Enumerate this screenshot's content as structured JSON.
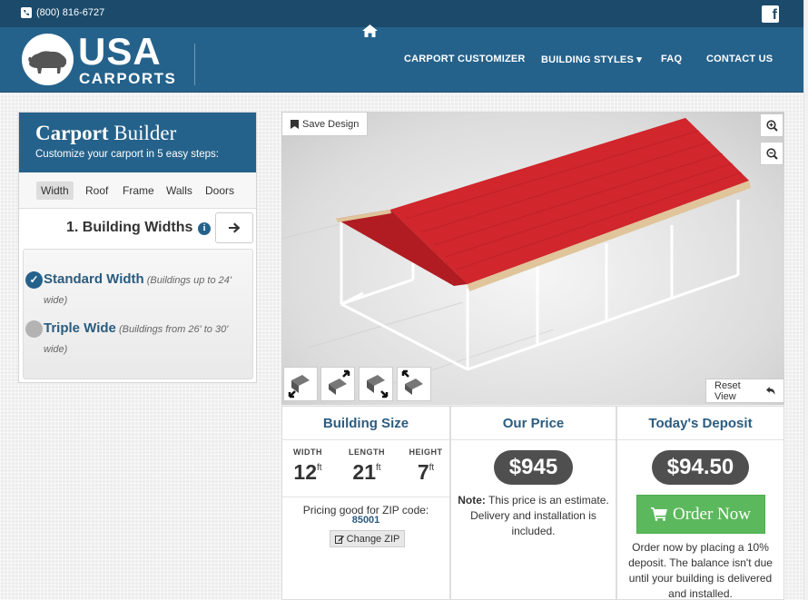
{
  "topbar": {
    "phone": "(800) 816-6727"
  },
  "logo": {
    "usa": "USA",
    "carports": "CARPORTS"
  },
  "nav": {
    "customizer": "CARPORT CUSTOMIZER",
    "styles": "BUILDING STYLES ▾",
    "faq": "FAQ",
    "contact": "CONTACT US"
  },
  "builder": {
    "title_bold": "Carport",
    "title_rest": " Builder",
    "subtitle": "Customize your carport in 5 easy steps:",
    "tabs": [
      "Width",
      "Roof",
      "Frame",
      "Walls",
      "Doors"
    ],
    "step_title": "1. Building Widths",
    "options": [
      {
        "label": "Standard Width",
        "desc": " (Buildings up to 24' wide)",
        "selected": true
      },
      {
        "label": "Triple Wide",
        "desc": " (Buildings from 26' to 30' wide)",
        "selected": false
      }
    ]
  },
  "viewer": {
    "save_label": "Save Design",
    "reset_label": "Reset View",
    "roof_color": "#c62026",
    "trim_color": "#e0c49a"
  },
  "size": {
    "heading": "Building Size",
    "width_label": "WIDTH",
    "width_val": "12",
    "width_unit": "ft",
    "length_label": "LENGTH",
    "length_val": "21",
    "length_unit": "ft",
    "height_label": "HEIGHT",
    "height_val": "7",
    "height_unit": "ft",
    "zip_text": "Pricing good for ZIP code:",
    "zip_code": "85001",
    "change_zip": "Change ZIP"
  },
  "price": {
    "heading": "Our Price",
    "amount": "$945",
    "note_bold": "Note:",
    "note_text": " This price is an estimate. Delivery and installation is included."
  },
  "deposit": {
    "heading": "Today's Deposit",
    "amount": "$94.50",
    "order_label": "Order Now",
    "note": "Order now by placing a 10% deposit. The balance isn't due until your building is delivered and installed."
  }
}
